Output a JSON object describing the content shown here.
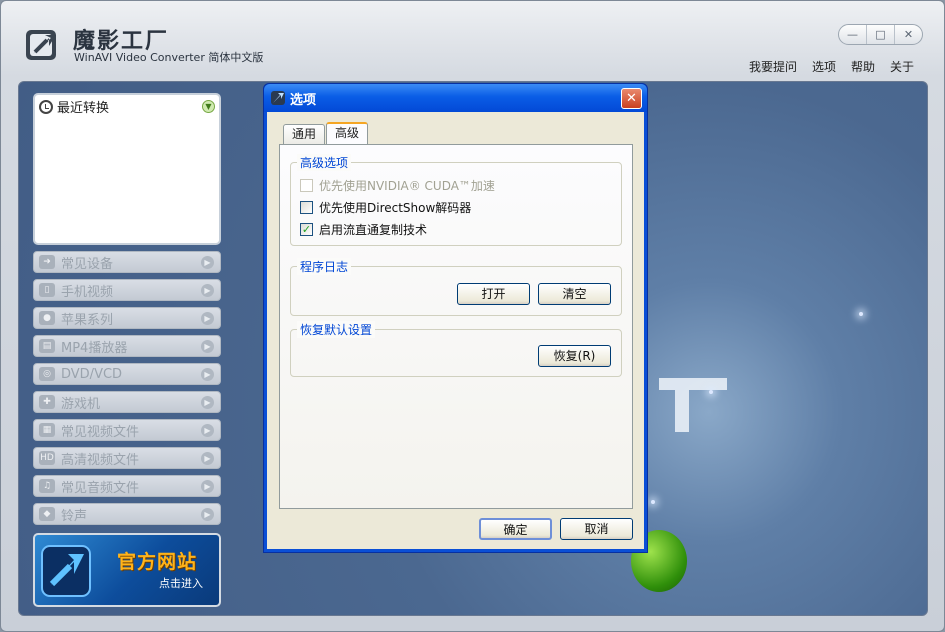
{
  "app": {
    "title": "魔影工厂",
    "subtitle": "WinAVI Video Converter 简体中文版",
    "window_controls": [
      "—",
      "□",
      "✕"
    ],
    "menu": [
      "我要提问",
      "选项",
      "帮助",
      "关于"
    ]
  },
  "sidebar": {
    "recent": {
      "label": "最近转换",
      "icon": "clock-icon"
    },
    "categories": [
      {
        "label": "常见设备",
        "icon": "device-icon"
      },
      {
        "label": "手机视频",
        "icon": "phone-icon"
      },
      {
        "label": "苹果系列",
        "icon": "apple-icon"
      },
      {
        "label": "MP4播放器",
        "icon": "mp4-icon"
      },
      {
        "label": "DVD/VCD",
        "icon": "disc-icon"
      },
      {
        "label": "游戏机",
        "icon": "gamepad-icon"
      },
      {
        "label": "常见视频文件",
        "icon": "film-icon"
      },
      {
        "label": "高清视频文件",
        "icon": "hd-icon"
      },
      {
        "label": "常见音频文件",
        "icon": "music-icon"
      },
      {
        "label": "铃声",
        "icon": "bell-icon"
      }
    ],
    "banner": {
      "title": "官方网站",
      "subtitle": "点击进入"
    }
  },
  "dialog": {
    "title": "选项",
    "close": "✕",
    "tabs": [
      "通用",
      "高级"
    ],
    "active_tab": "高级",
    "advanced": {
      "legend": "高级选项",
      "options": [
        {
          "label": "优先使用NVIDIA® CUDA™加速",
          "checked": false,
          "disabled": true
        },
        {
          "label": "优先使用DirectShow解码器",
          "checked": false,
          "disabled": false
        },
        {
          "label": "启用流直通复制技术",
          "checked": true,
          "disabled": false
        }
      ]
    },
    "log": {
      "legend": "程序日志",
      "open": "打开",
      "clear": "清空"
    },
    "restore": {
      "legend": "恢复默认设置",
      "button": "恢复(R)"
    },
    "ok": "确定",
    "cancel": "取消"
  },
  "colors": {
    "accent": "#0a5de6",
    "main_bg": "#4b6890",
    "banner_text": "#ffb319"
  }
}
